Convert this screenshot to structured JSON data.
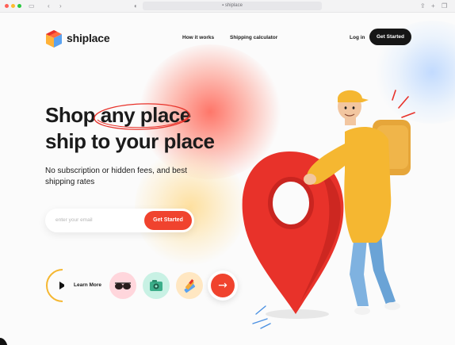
{
  "browser": {
    "url": "shiplace",
    "icons": [
      "close-dot",
      "minimize-dot",
      "zoom-dot",
      "sidebar-icon",
      "back-icon",
      "forward-icon",
      "shield-icon",
      "lock-icon",
      "share-icon",
      "new-tab-icon",
      "tabs-icon"
    ]
  },
  "nav": {
    "brand": "shiplace",
    "links": [
      "How it works",
      "Shipping calculator"
    ],
    "login": "Log in",
    "cta": "Get Started"
  },
  "hero": {
    "line1_pre": "Shop",
    "line1_highlight": "any place",
    "line2": "ship to your place",
    "subtitle": "No subscription or hidden fees, and best shipping rates"
  },
  "signup": {
    "placeholder": "enter your email",
    "button": "Get Started"
  },
  "learn": {
    "label": "Learn More"
  },
  "chips": [
    {
      "icon": "sunglasses-icon",
      "color": "#ffd6dc"
    },
    {
      "icon": "camera-icon",
      "color": "#c8f1e4"
    },
    {
      "icon": "brush-icon",
      "color": "#ffe7c2"
    }
  ],
  "colors": {
    "accent": "#f0432e",
    "dark": "#161616",
    "courier_shirt": "#f5b731",
    "courier_jeans": "#7fb2e0",
    "pin": "#e8322a"
  }
}
